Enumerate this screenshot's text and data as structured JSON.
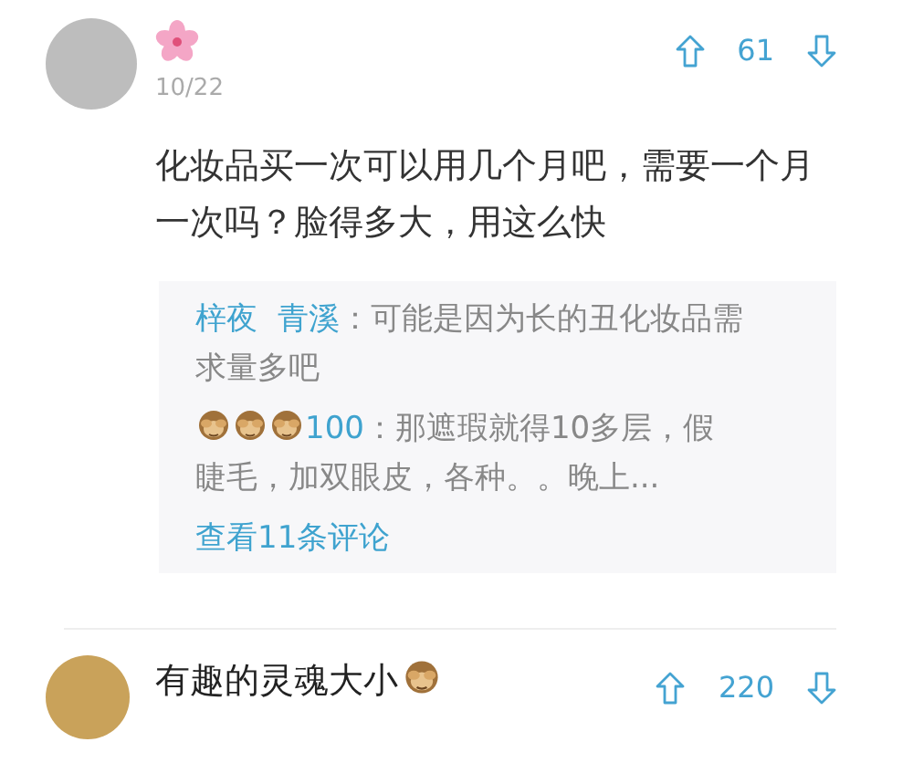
{
  "comments": [
    {
      "kind": "flower",
      "date": "10/22",
      "votes": "61",
      "text": "化妆品买一次可以用几个月吧，需要一个月一次吗？脸得多大，用这么快",
      "replies": [
        {
          "kind": "plain",
          "authors": [
            "梓夜",
            "青溪"
          ],
          "text": "：可能是因为长的丑化妆品需求量多吧"
        },
        {
          "kind": "monkeys",
          "authors": [
            "100"
          ],
          "text": "：那遮瑕就得10多层，假睫毛，加双眼皮，各种。。晚上..."
        }
      ],
      "more_link": "查看11条评论"
    },
    {
      "kind": "monkey-suffix",
      "name": "有趣的灵魂大小",
      "votes": "220"
    }
  ]
}
